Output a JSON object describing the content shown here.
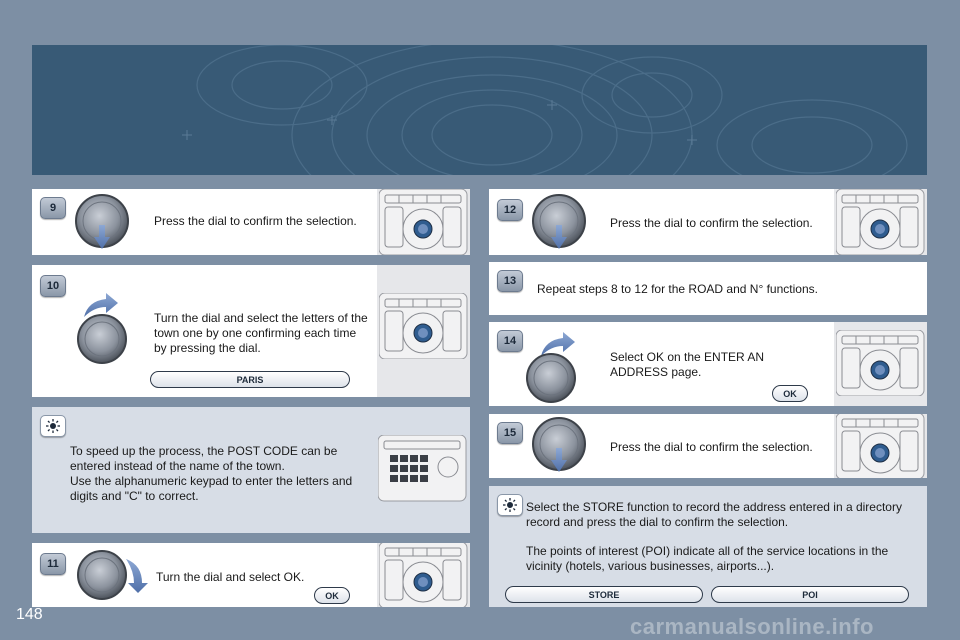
{
  "page_number": "148",
  "watermark": "carmanualsonline.info",
  "steps": [
    {
      "badge": "9",
      "text": "Press the dial to confirm the selection."
    },
    {
      "badge": "10",
      "text": "Turn the dial and select the letters of the town one by one confirming each time by pressing the dial.",
      "pill": "PARIS"
    },
    {
      "tip_lines": [
        "To speed up the process, the POST CODE can be entered instead of the name of the town.",
        "Use the alphanumeric keypad to enter the letters and digits and \"C\" to correct."
      ]
    },
    {
      "badge": "11",
      "text": "Turn the dial and select OK.",
      "pill": "OK"
    },
    {
      "badge": "12",
      "text": "Press the dial to confirm the selection."
    },
    {
      "badge": "13",
      "text": "Repeat steps 8 to 12 for the ROAD and N° functions."
    },
    {
      "badge": "14",
      "text": "Select OK on the ENTER AN ADDRESS page.",
      "pill": "OK"
    },
    {
      "badge": "15",
      "text": "Press the dial to confirm the selection."
    },
    {
      "tip_paragraphs": [
        "Select the STORE function to record the address entered in a directory record and press the dial to confirm the selection.",
        "The points of interest (POI) indicate all of the service locations in the vicinity (hotels, various businesses, airports...)."
      ],
      "pills": [
        "STORE",
        "POI"
      ]
    }
  ],
  "icons": {
    "dial": "rotary-dial-icon",
    "press_arrow": "press-arrow-icon",
    "turn_arrow": "turn-arrow-icon",
    "tip": "lightbulb-icon",
    "device": "control-panel-icon",
    "keypad": "keypad-panel-icon"
  },
  "colors": {
    "background": "#7d8fa4",
    "banner": "#385a76",
    "tip_card": "#d7dde6",
    "card": "#ffffff"
  }
}
